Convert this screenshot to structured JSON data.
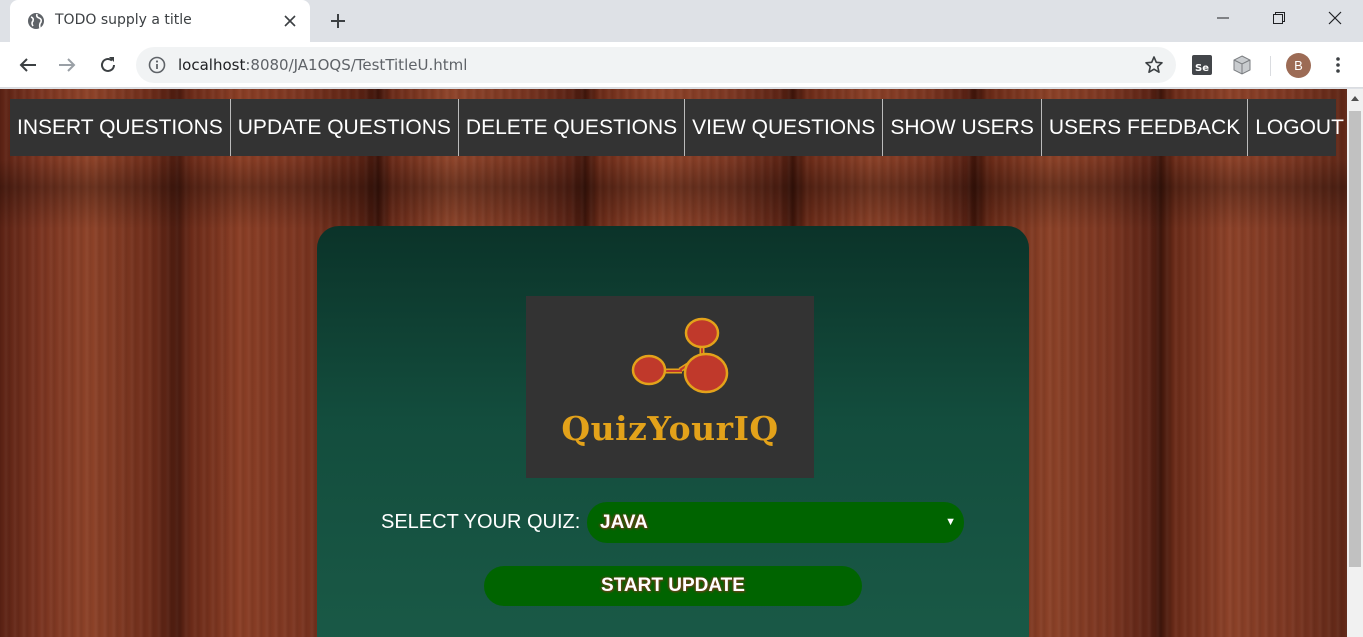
{
  "browser": {
    "tab": {
      "title": "TODO supply a title",
      "favicon": "globe-icon"
    },
    "url": {
      "host": "localhost",
      "path": ":8080/JA1OQS/TestTitleU.html"
    },
    "profile_initial": "B",
    "colors": {
      "tabstrip": "#dee1e6",
      "toolbar": "#ffffff",
      "omnibox": "#f1f3f4"
    }
  },
  "nav": {
    "items": [
      {
        "label": "INSERT QUESTIONS"
      },
      {
        "label": "UPDATE QUESTIONS"
      },
      {
        "label": "DELETE QUESTIONS"
      },
      {
        "label": "VIEW QUESTIONS"
      },
      {
        "label": "SHOW USERS"
      },
      {
        "label": "USERS FEEDBACK"
      },
      {
        "label": "LOGOUT"
      }
    ],
    "background": "#333333"
  },
  "card": {
    "logo_text": "QuizYourIQ",
    "select_label": "SELECT YOUR QUIZ:",
    "selected_quiz": "JAVA",
    "start_button": "START UPDATE",
    "colors": {
      "card_top": "#0b3329",
      "card_bottom": "#1a5a47",
      "control": "#006400",
      "logo_text": "#e3a21a",
      "logo_node": "#c0392b"
    }
  }
}
